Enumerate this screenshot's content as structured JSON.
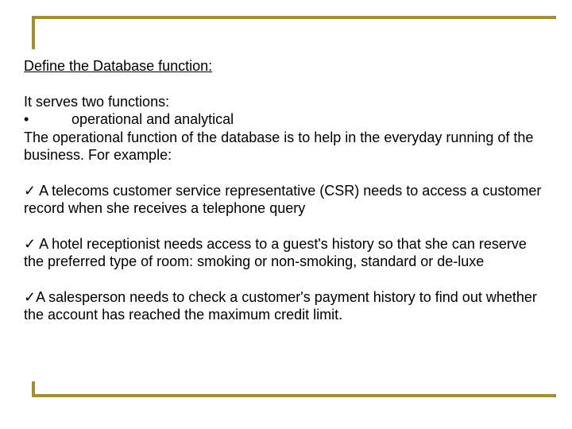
{
  "title": "Define the Database function:",
  "intro": {
    "line1": "It serves two functions:",
    "bullet_symbol": "•",
    "bullet_text": "operational and analytical",
    "line3": "The operational function of the database is to help in the everyday running of the business. For example:"
  },
  "check_symbol": "✓",
  "examples": [
    " A telecoms customer service representative (CSR) needs to access a customer record when she receives a telephone query",
    " A hotel receptionist needs access to a guest's history so that she can reserve the preferred type of room: smoking or non-smoking, standard or de-luxe",
    "A salesperson needs to check a customer's payment history to find out whether the account has reached the maximum credit limit."
  ],
  "frame_color": "#a38f32"
}
